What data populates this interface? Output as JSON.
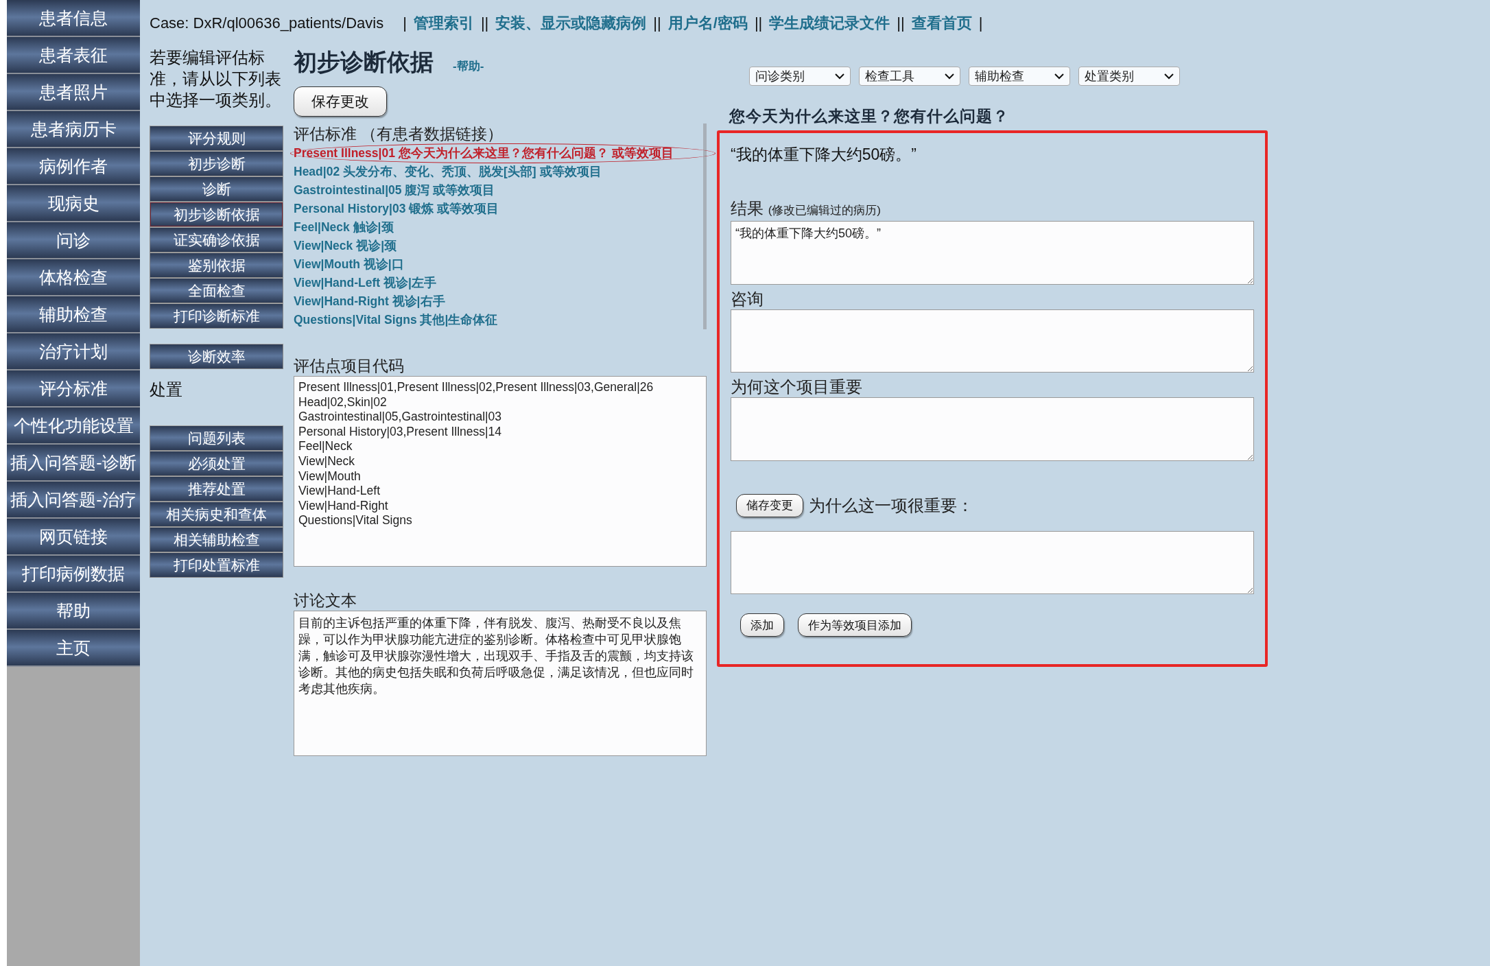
{
  "sidebar": {
    "items": [
      {
        "label": "患者信息"
      },
      {
        "label": "患者表征"
      },
      {
        "label": "患者照片"
      },
      {
        "label": "患者病历卡"
      },
      {
        "label": "病例作者"
      },
      {
        "label": "现病史"
      },
      {
        "label": "问诊"
      },
      {
        "label": "体格检查"
      },
      {
        "label": "辅助检查"
      },
      {
        "label": "治疗计划"
      },
      {
        "label": "评分标准"
      },
      {
        "label": "个性化功能设置"
      },
      {
        "label": "插入问答题-诊断"
      },
      {
        "label": "插入问答题-治疗"
      },
      {
        "label": "网页链接"
      },
      {
        "label": "打印病例数据"
      },
      {
        "label": "帮助"
      },
      {
        "label": "主页"
      }
    ]
  },
  "header": {
    "case": "Case: DxR/ql00636_patients/Davis",
    "nav": [
      {
        "kind": "sep",
        "text": "|"
      },
      {
        "kind": "link",
        "text": "管理索引"
      },
      {
        "kind": "sep",
        "text": "||"
      },
      {
        "kind": "link",
        "text": "安装、显示或隐藏病例"
      },
      {
        "kind": "sep",
        "text": "||"
      },
      {
        "kind": "link",
        "text": "用户名/密码"
      },
      {
        "kind": "sep",
        "text": "||"
      },
      {
        "kind": "link",
        "text": "学生成绩记录文件"
      },
      {
        "kind": "sep",
        "text": "||"
      },
      {
        "kind": "link",
        "text": "查看首页"
      },
      {
        "kind": "sep",
        "text": "|"
      }
    ]
  },
  "instructions": "若要编辑评估标准，请从以下列表中选择一项类别。",
  "criteria_buttons": [
    {
      "label": "评分规则",
      "selected": false
    },
    {
      "label": "初步诊断",
      "selected": false
    },
    {
      "label": "诊断",
      "selected": false
    },
    {
      "label": "初步诊断依据",
      "selected": true
    },
    {
      "label": "证实确诊依据",
      "selected": false
    },
    {
      "label": "鉴别依据",
      "selected": false
    },
    {
      "label": "全面检查",
      "selected": false
    },
    {
      "label": "打印诊断标准",
      "selected": false
    }
  ],
  "efficiency_button": "诊断效率",
  "disposal_heading": "处置",
  "disposal_buttons": [
    {
      "label": "问题列表",
      "selected": false
    },
    {
      "label": "必须处置",
      "selected": false
    },
    {
      "label": "推荐处置",
      "selected": false
    },
    {
      "label": "相关病史和查体",
      "selected": false
    },
    {
      "label": "相关辅助检查",
      "selected": false
    },
    {
      "label": "打印处置标准",
      "selected": false
    }
  ],
  "page_title": "初步诊断依据",
  "help_link": "-帮助-",
  "save_button": "保存更改",
  "criteria": {
    "heading": "评估标准 （有患者数据链接）",
    "items": [
      {
        "label": "Present Illness|01 您今天为什么来这里？您有什么问题？ 或等效项目",
        "selected": true
      },
      {
        "label": "Head|02 头发分布、变化、秃顶、脱发[头部] 或等效项目",
        "selected": false
      },
      {
        "label": "Gastrointestinal|05 腹泻 或等效项目",
        "selected": false
      },
      {
        "label": "Personal History|03 锻炼 或等效项目",
        "selected": false
      },
      {
        "label": "Feel|Neck 触诊|颈",
        "selected": false
      },
      {
        "label": "View|Neck 视诊|颈",
        "selected": false
      },
      {
        "label": "View|Mouth 视诊|口",
        "selected": false
      },
      {
        "label": "View|Hand-Left 视诊|左手",
        "selected": false
      },
      {
        "label": "View|Hand-Right 视诊|右手",
        "selected": false
      },
      {
        "label": "Questions|Vital Signs 其他|生命体征",
        "selected": false
      }
    ]
  },
  "codes": {
    "heading": "评估点项目代码",
    "lines": [
      "Present Illness|01,Present Illness|02,Present Illness|03,General|26",
      "Head|02,Skin|02",
      "Gastrointestinal|05,Gastrointestinal|03",
      "Personal History|03,Present Illness|14",
      "Feel|Neck",
      "View|Neck",
      "View|Mouth",
      "View|Hand-Left",
      "View|Hand-Right",
      "Questions|Vital Signs"
    ]
  },
  "discussion": {
    "heading": "讨论文本",
    "text": "目前的主诉包括严重的体重下降，伴有脱发、腹泻、热耐受不良以及焦躁，可以作为甲状腺功能亢进症的鉴别诊断。体格检查中可见甲状腺饱满，触诊可及甲状腺弥漫性增大，出现双手、手指及舌的震颤，均支持该诊断。其他的病史包括失眠和负荷后呼吸急促，满足该情况，但也应同时考虑其他疾病。"
  },
  "dropdowns": [
    "问诊类别",
    "检查工具",
    "辅助检查",
    "处置类别"
  ],
  "question": "您今天为什么来这里？您有什么问题？",
  "panel": {
    "quote": "“我的体重下降大约50磅。”",
    "result_label": "结果",
    "result_note": "(修改已编辑过的病历)",
    "result_value": "“我的体重下降大约50磅。”",
    "consult_label": "咨询",
    "why_label": "为何这个项目重要",
    "save_button": "储存变更",
    "why_prompt": "为什么这一项很重要：",
    "add_button": "添加",
    "add_equiv_button": "作为等效项目添加"
  }
}
